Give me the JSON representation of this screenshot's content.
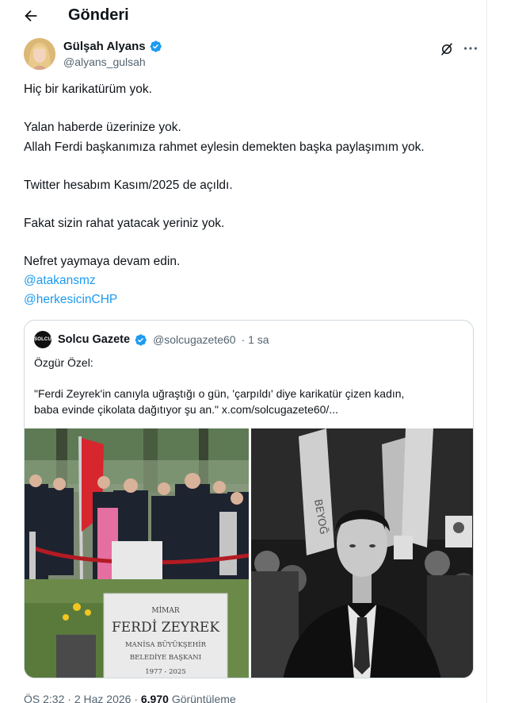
{
  "header": {
    "title": "Gönderi"
  },
  "post": {
    "author_name": "Gülşah Alyans",
    "author_handle": "@alyans_gulsah",
    "lines": [
      "Hiç bir karikatürüm yok.",
      "Yalan haberde üzerinize yok.",
      "Allah Ferdi başkanımıza rahmet eylesin demekten başka paylaşımım yok.",
      "Twitter hesabım Kasım/2025 de açıldı.",
      "Fakat sizin rahat yatacak yeriniz yok.",
      "Nefret yaymaya devam edin."
    ],
    "mentions": [
      "@atakansmz",
      "@herkesicinCHP"
    ]
  },
  "quote": {
    "avatar_text": "SOLCU",
    "name": "Solcu Gazete",
    "handle": "@solcugazete60",
    "time": "· 1 sa",
    "line1": "Özgür Özel:",
    "line2": "\"Ferdi Zeyrek'in canıyla uğraştığı o gün, 'çarpıldı' diye karikatür çizen kadın,",
    "line3": "baba evinde çikolata dağıtıyor şu an.\"",
    "link": "x.com/solcugazete60/...",
    "grave": {
      "line1": "MİMAR",
      "line2": "FERDİ ZEYREK",
      "line3": "MANİSA BÜYÜKŞEHİR",
      "line4": "BELEDİYE BAŞKANI",
      "line5": "1977 - 2025"
    },
    "sign_text": "BEYOĞ"
  },
  "meta": {
    "time": "ÖS 2:32",
    "date": "· 2 Haz 2026 ·",
    "views": "6.970",
    "views_label": "Görüntüleme"
  },
  "colors": {
    "link": "#1d9bf0",
    "text": "#0f1419",
    "muted": "#536471",
    "border": "#cfd9de"
  }
}
